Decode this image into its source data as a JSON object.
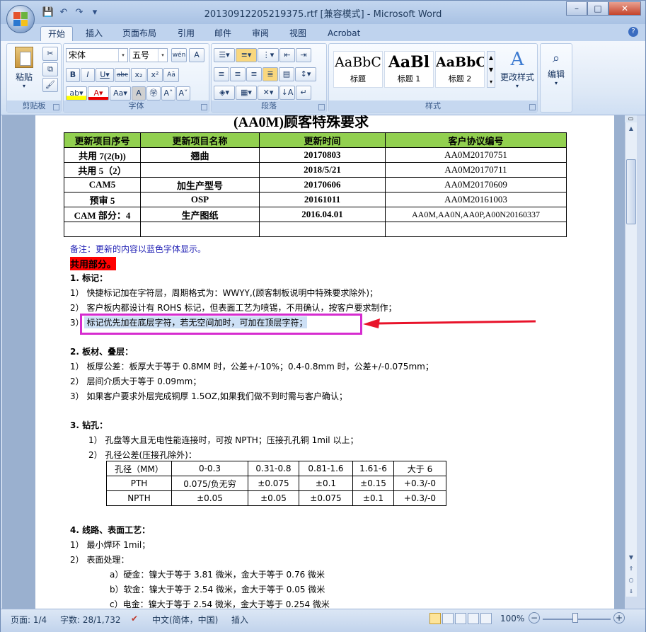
{
  "window": {
    "title": "20130912205219375.rtf [兼容模式] - Microsoft Word",
    "controls": {
      "minimize": "–",
      "maximize": "□",
      "close": "✕"
    }
  },
  "qat": {
    "save": "💾",
    "undo": "↶",
    "redo": "↷",
    "dropdown": "▾"
  },
  "tabs": [
    "开始",
    "插入",
    "页面布局",
    "引用",
    "邮件",
    "审阅",
    "视图",
    "Acrobat"
  ],
  "ribbon": {
    "clipboard": {
      "label": "剪贴板",
      "paste": "粘贴"
    },
    "font": {
      "label": "字体",
      "family": "宋体",
      "size": "五号"
    },
    "paragraph": {
      "label": "段落"
    },
    "styles": {
      "label": "样式",
      "items": [
        {
          "sample": "AaBbC",
          "name": "标题"
        },
        {
          "sample": "AaBl",
          "name": "标题 1"
        },
        {
          "sample": "AaBbC",
          "name": "标题 2"
        }
      ],
      "change_styles": "更改样式"
    },
    "editing": {
      "label": "编辑"
    }
  },
  "document": {
    "heading_partial": "(AA0M)顾客特殊要求",
    "table1": {
      "headers": [
        "更新项目序号",
        "更新项目名称",
        "更新时间",
        "客户协议编号"
      ],
      "rows": [
        [
          "共用 7(2(b))",
          "翘曲",
          "20170803",
          "AA0M20170751"
        ],
        [
          "共用 5（2）",
          "",
          "2018/5/21",
          "AA0M20170711"
        ],
        [
          "CAM5",
          "加生产型号",
          "20170606",
          "AA0M20170609"
        ],
        [
          "预审 5",
          "OSP",
          "20161011",
          "AA0M20161003"
        ],
        [
          "CAM 部分：4",
          "生产图纸",
          "2016.04.01",
          "AA0M,AA0N,AA0P,A00N20160337"
        ],
        [
          "",
          "",
          "",
          ""
        ]
      ]
    },
    "note": "备注：更新的内容以蓝色字体显示。",
    "shared_section": "共用部分。",
    "s1_title": "1.   标记：",
    "s1_items": [
      "1） 快捷标记加在字符层，周期格式为：WWYY,(顾客制板说明中特殊要求除外)；",
      "2） 客户板内都设计有 ROHS 标记，但表面工艺为喷锡，不用确认，按客户要求制作；",
      "3） 标记优先加在底层字符，若无空间加时，可加在顶层字符；"
    ],
    "s2_title": "2.   板材、叠层：",
    "s2_items": [
      "1） 板厚公差：板厚大于等于 0.8MM 时，公差+/-10%；0.4-0.8mm 时，公差+/-0.075mm；",
      "2） 层间介质大于等于 0.09mm；",
      "3） 如果客户要求外层完成铜厚 1.5OZ,如果我们做不到时需与客户确认；"
    ],
    "s3_title": "3.   钻孔：",
    "s3_items": [
      "1） 孔盘等大且无电性能连接时，可按 NPTH；压接孔孔铜 1mil 以上；",
      "2） 孔径公差(压接孔除外)："
    ],
    "table2": {
      "headers": [
        "孔径（MM）",
        "0-0.3",
        "0.31-0.8",
        "0.81-1.6",
        "1.61-6",
        "大于 6"
      ],
      "rows": [
        [
          "PTH",
          "0.075/负无穷",
          "±0.075",
          "±0.1",
          "±0.15",
          "+0.3/-0"
        ],
        [
          "NPTH",
          "±0.05",
          "±0.05",
          "±0.075",
          "±0.1",
          "+0.3/-0"
        ]
      ]
    },
    "s4_title": "4.   线路、表面工艺：",
    "s4_items": [
      "1） 最小焊环 1mil；",
      "2） 表面处理："
    ],
    "s4_sub": [
      "a）硬金：镍大于等于 3.81 微米，金大于等于 0.76 微米",
      "b）软金：镍大于等于 2.54 微米，金大于等于 0.05 微米",
      "c）电金：镍大于等于 2.54 微米，金大于等于 0.254 微米"
    ]
  },
  "status": {
    "page": "页面: 1/4",
    "words": "字数: 28/1,732",
    "language": "中文(简体，中国)",
    "mode": "插入",
    "zoom": "100%"
  },
  "colors": {
    "highlight_box": "#d62ccf",
    "table_header": "#92d050",
    "note_blue": "#1f1fb4"
  }
}
